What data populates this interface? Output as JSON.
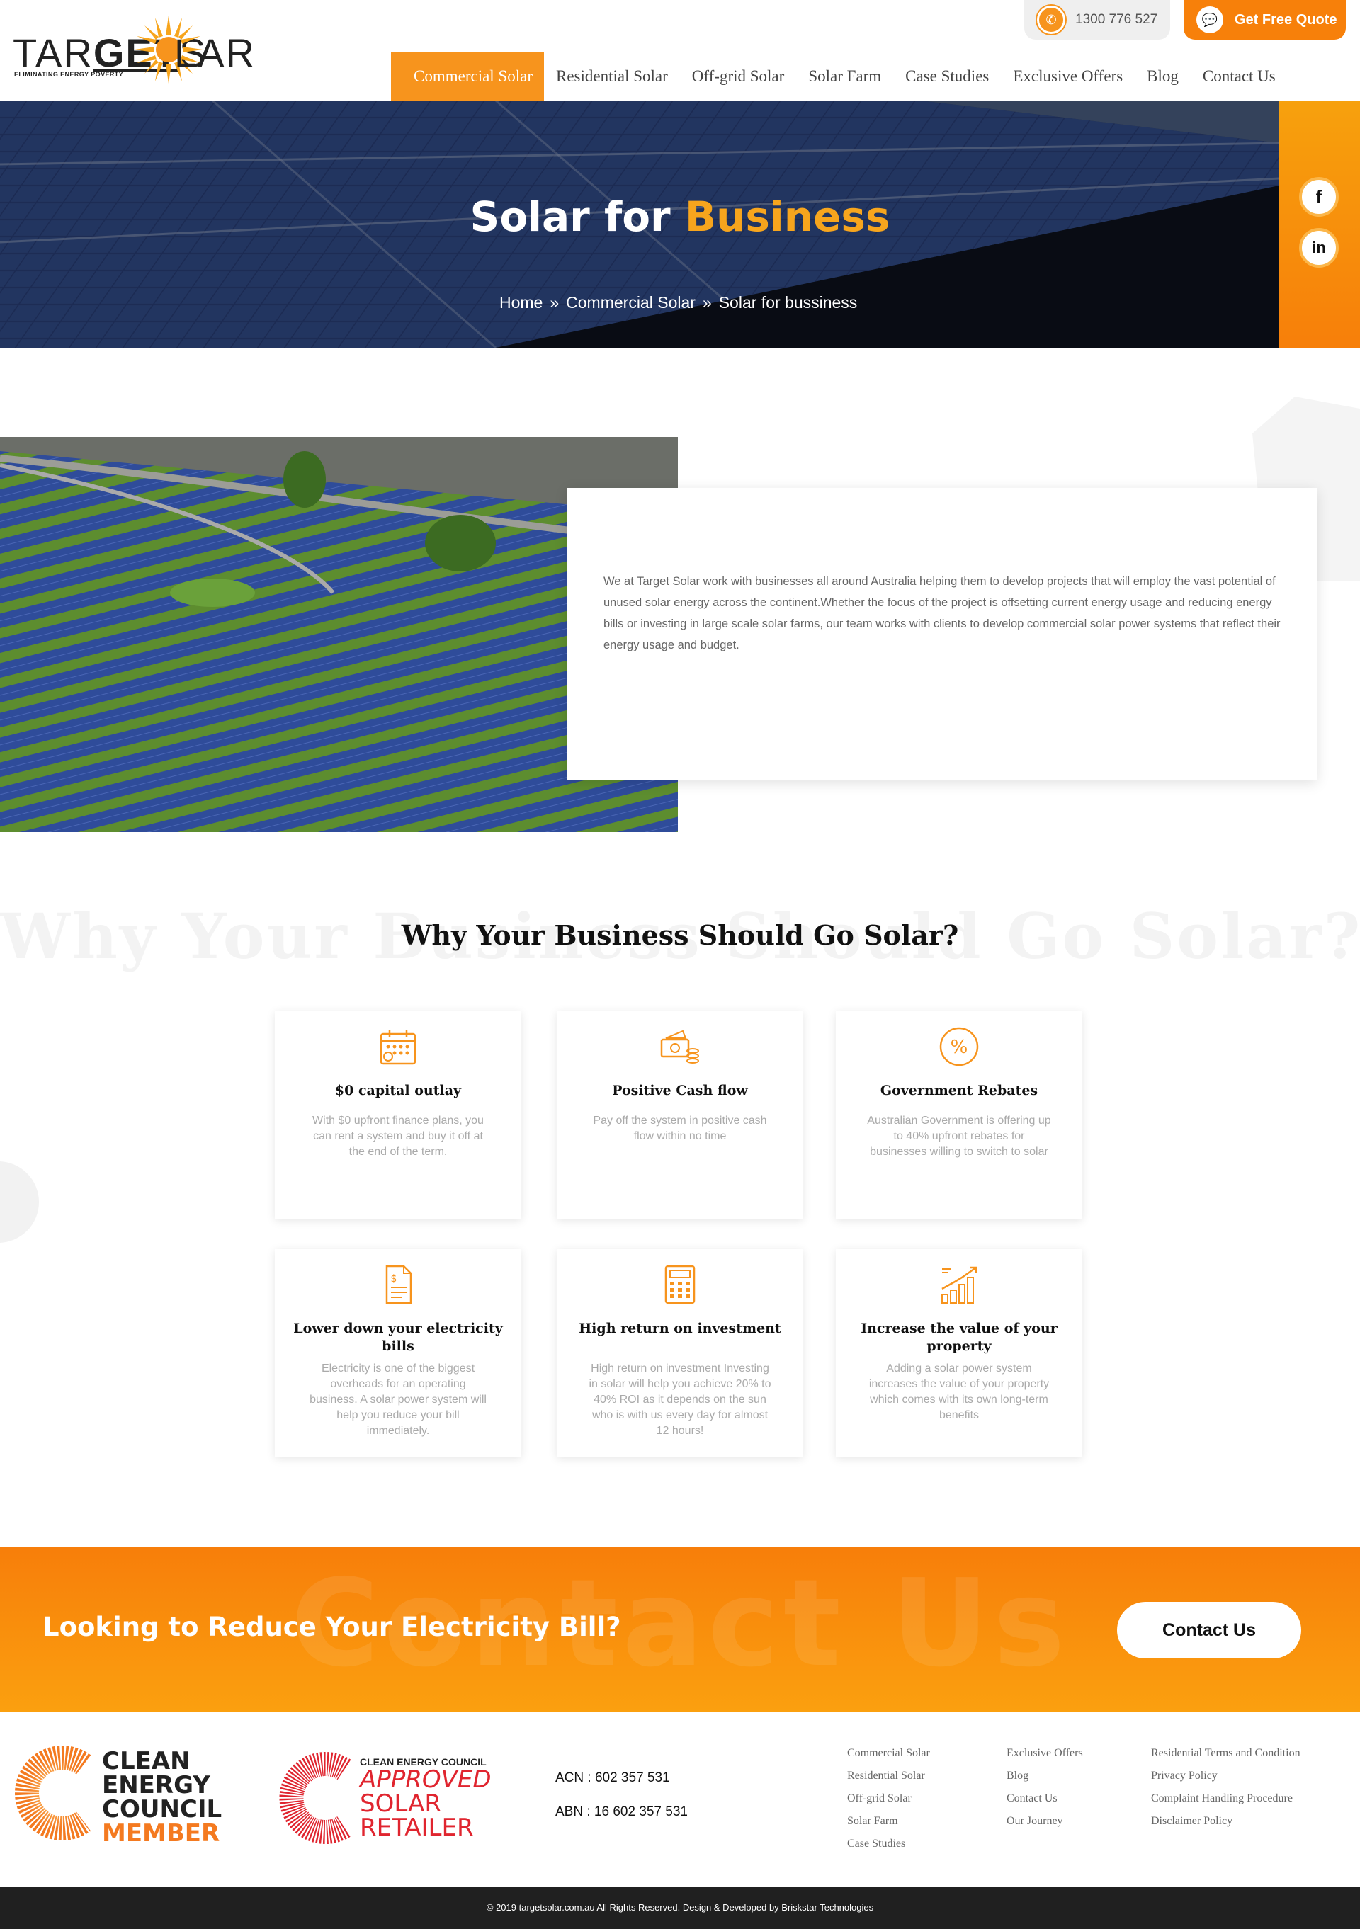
{
  "brand": {
    "logo_left": "TAR",
    "logo_middle": "GET",
    "logo_right": "LAR",
    "tagline": "ELIMINATING ENERGY POVERTY"
  },
  "top_bar": {
    "phone": "1300 776 527",
    "quote_label": "Get Free Quote"
  },
  "nav": {
    "items": [
      {
        "label": "Commercial Solar",
        "active": true
      },
      {
        "label": "Residential Solar"
      },
      {
        "label": "Off-grid Solar"
      },
      {
        "label": "Solar Farm"
      },
      {
        "label": "Case Studies"
      },
      {
        "label": "Exclusive Offers"
      },
      {
        "label": "Blog"
      },
      {
        "label": "Contact Us"
      }
    ]
  },
  "hero": {
    "title_main": "Solar for ",
    "title_highlight": "Business",
    "breadcrumb": [
      "Home",
      "Commercial Solar",
      "Solar for bussiness"
    ]
  },
  "social": [
    "facebook-icon",
    "linkedin-icon"
  ],
  "intro": {
    "text": "We at Target Solar work with businesses all around Australia helping them to develop projects that will employ the vast potential of unused solar energy across the continent.Whether the focus of the project is offsetting current energy usage and reducing energy bills or investing in large scale solar farms, our team works with clients to develop commercial solar power systems that reflect their energy usage and budget."
  },
  "why": {
    "background_text": "Why Your Business Should Go Solar?",
    "title": "Why Your Business Should Go Solar?",
    "cards": [
      {
        "icon": "calendar-icon",
        "title": "$0 capital outlay",
        "text": "With $0 upfront finance plans, you can rent a system and buy it off at the end of the term."
      },
      {
        "icon": "cash-icon",
        "title": "Positive Cash flow",
        "text": "Pay off the system in positive cash flow within no time"
      },
      {
        "icon": "percent-icon",
        "title": "Government Rebates",
        "text": "Australian Government is offering up to 40% upfront rebates for businesses willing to switch to solar"
      },
      {
        "icon": "bill-icon",
        "title": "Lower down your electricity bills",
        "text": "Electricity is one of the biggest overheads for an operating business. A solar power system will help you reduce your bill immediately."
      },
      {
        "icon": "calculator-icon",
        "title": "High return on investment",
        "text": "High return on investment Investing in solar will help you achieve 20% to 40% ROI as it depends on the sun who is with us every day for almost 12 hours!"
      },
      {
        "icon": "growth-chart-icon",
        "title": "Increase the value of your property",
        "text": "Adding a solar power system increases the value of your property which comes with its own long-term benefits"
      }
    ]
  },
  "cta": {
    "background_text": "Contact Us",
    "title": "Looking to Reduce Your Electricity Bill?",
    "button": "Contact Us"
  },
  "footer": {
    "badge1": {
      "line1": "CLEAN",
      "line2": "ENERGY",
      "line3": "COUNCIL",
      "line4": "MEMBER"
    },
    "badge2": {
      "top": "CLEAN ENERGY COUNCIL",
      "line1": "APPROVED",
      "line2": "SOLAR",
      "line3": "RETAILER"
    },
    "acn": "ACN : 602 357 531",
    "abn": "ABN : 16 602 357 531",
    "col1": [
      "Commercial Solar",
      "Residential Solar",
      "Off-grid Solar",
      "Solar Farm",
      "Case Studies"
    ],
    "col2": [
      "Exclusive Offers",
      "Blog",
      "Contact Us",
      "Our Journey"
    ],
    "col3": [
      "Residential Terms and Condition",
      "Privacy Policy",
      "Complaint Handling Procedure",
      "Disclaimer Policy"
    ],
    "copyright": "© 2019 targetsolar.com.au All Rights Reserved. Design & Developed by Briskstar Technologies"
  },
  "colors": {
    "accent": "#f7941d",
    "accent_dark": "#f77e0a",
    "footer_dark": "#202020"
  }
}
